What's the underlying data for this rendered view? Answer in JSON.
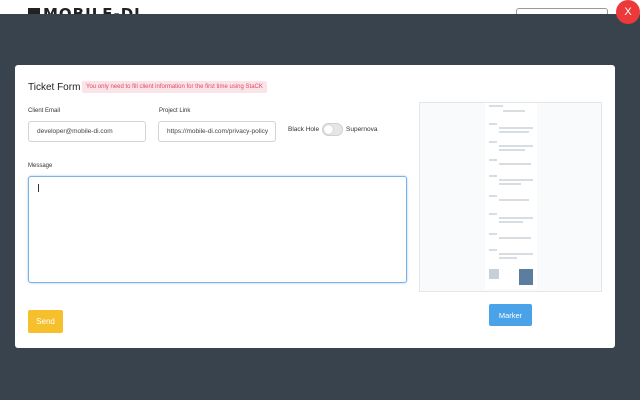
{
  "background": {
    "logo_text": "MOBILE-DI"
  },
  "close_label": "X",
  "form": {
    "title": "Ticket Form",
    "notice": "You only need to fill client information for the first time using StaCK",
    "client_email": {
      "label": "Client Email",
      "value": "developer@mobile-di.com"
    },
    "project_link": {
      "label": "Project Link",
      "value": "https://mobile-di.com/privacy-policy"
    },
    "toggle": {
      "left_label": "Black Hole",
      "right_label": "Supernova",
      "state": "Black Hole"
    },
    "message": {
      "label": "Message",
      "value": ""
    },
    "send_label": "Send"
  },
  "marker_label": "Marker",
  "colors": {
    "overlay": "#38434e",
    "send": "#f6c02c",
    "marker": "#4aa3e8",
    "close": "#ec3a3a",
    "notice_text": "#e04765"
  }
}
